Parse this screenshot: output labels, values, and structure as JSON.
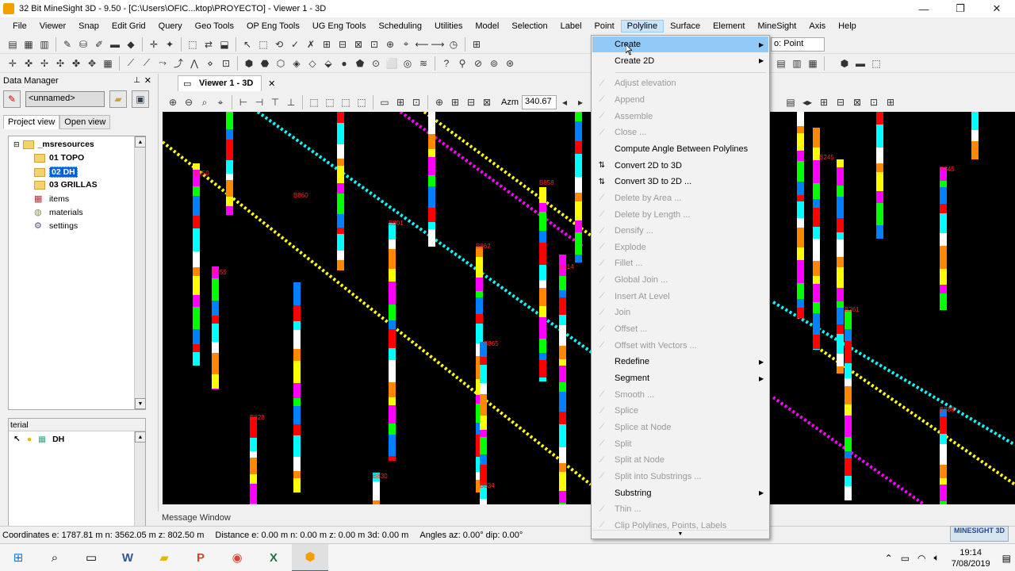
{
  "window": {
    "title": "32 Bit MineSight 3D  - 9.50 - [C:\\Users\\OFIC...ktop\\PROYECTO] - Viewer 1 - 3D",
    "minimize": "—",
    "restore": "❐",
    "close": "✕"
  },
  "menubar": [
    "File",
    "Viewer",
    "Snap",
    "Edit Grid",
    "Query",
    "Geo Tools",
    "OP Eng Tools",
    "UG Eng Tools",
    "Scheduling",
    "Utilities",
    "Model",
    "Selection",
    "Label",
    "Point",
    "Polyline",
    "Surface",
    "Element",
    "MineSight",
    "Axis",
    "Help"
  ],
  "active_menu": "Polyline",
  "toolbar": {
    "snap_mode_text": "o: Point"
  },
  "data_manager": {
    "title": "Data Manager",
    "pin": "📌",
    "close": "✕",
    "combo_value": "<unnamed>",
    "tabs": [
      "Project view",
      "Open view"
    ],
    "tree": [
      {
        "label": "_msresources",
        "type": "folder",
        "bold": true
      },
      {
        "label": "01 TOPO",
        "type": "folder",
        "bold": true
      },
      {
        "label": "02 DH",
        "type": "folder",
        "bold": true,
        "selected": true
      },
      {
        "label": "03 GRILLAS",
        "type": "folder",
        "bold": true
      },
      {
        "label": "items",
        "type": "items",
        "bold": false
      },
      {
        "label": "materials",
        "type": "materials",
        "bold": false
      },
      {
        "label": "settings",
        "type": "settings",
        "bold": false
      }
    ],
    "material_header": "terial",
    "material_row": "DH"
  },
  "viewer": {
    "tab_label": "Viewer 1 - 3D",
    "azm_label": "Azm",
    "azm_value": "340.67",
    "message_window": "Message Window"
  },
  "statusbar": {
    "coordinates": "Coordinates  e: 1787.81 m  n: 3562.05 m  z: 802.50 m",
    "distance": "Distance  e: 0.00 m  n: 0.00 m  z: 0.00 m  3d: 0.00 m",
    "angles": "Angles  az:  0.00°  dip: 0.00°",
    "logo": "MINESIGHT 3D"
  },
  "polyline_menu": {
    "items": [
      {
        "label": "Create",
        "enabled": true,
        "submenu": true,
        "highlight": true,
        "icon": ""
      },
      {
        "label": "Create 2D",
        "enabled": true,
        "submenu": true,
        "icon": ""
      },
      {
        "sep": true
      },
      {
        "label": "Adjust elevation",
        "enabled": false,
        "icon": "adjust-icon"
      },
      {
        "label": "Append",
        "enabled": false,
        "icon": "append-icon"
      },
      {
        "label": "Assemble",
        "enabled": false,
        "icon": "assemble-icon"
      },
      {
        "label": "Close ...",
        "enabled": false,
        "icon": "close-poly-icon"
      },
      {
        "label": "Compute Angle Between Polylines",
        "enabled": true,
        "icon": ""
      },
      {
        "label": "Convert 2D to 3D",
        "enabled": true,
        "icon": "convert-2d-3d-icon"
      },
      {
        "label": "Convert 3D to 2D ...",
        "enabled": true,
        "icon": "convert-3d-2d-icon"
      },
      {
        "label": "Delete by Area ...",
        "enabled": false,
        "icon": "delete-area-icon"
      },
      {
        "label": "Delete by Length ...",
        "enabled": false,
        "icon": "delete-length-icon"
      },
      {
        "label": "Densify ...",
        "enabled": false,
        "icon": "densify-icon"
      },
      {
        "label": "Explode",
        "enabled": false,
        "icon": "explode-icon"
      },
      {
        "label": "Fillet ...",
        "enabled": false,
        "icon": "fillet-icon"
      },
      {
        "label": "Global Join ...",
        "enabled": false,
        "icon": "global-join-icon"
      },
      {
        "label": "Insert At Level",
        "enabled": false,
        "icon": "insert-level-icon"
      },
      {
        "label": "Join",
        "enabled": false,
        "icon": "join-icon"
      },
      {
        "label": "Offset ...",
        "enabled": false,
        "icon": "offset-icon"
      },
      {
        "label": "Offset with Vectors ...",
        "enabled": false,
        "icon": "offset-vectors-icon"
      },
      {
        "label": "Redefine",
        "enabled": true,
        "submenu": true,
        "icon": ""
      },
      {
        "label": "Segment",
        "enabled": true,
        "submenu": true,
        "icon": ""
      },
      {
        "label": "Smooth ...",
        "enabled": false,
        "icon": "smooth-icon"
      },
      {
        "label": "Splice",
        "enabled": false,
        "icon": "splice-icon"
      },
      {
        "label": "Splice at Node",
        "enabled": false,
        "icon": "splice-node-icon"
      },
      {
        "label": "Split",
        "enabled": false,
        "icon": "split-icon"
      },
      {
        "label": "Split at Node",
        "enabled": false,
        "icon": "split-node-icon"
      },
      {
        "label": "Split into Substrings ...",
        "enabled": false,
        "icon": "split-substrings-icon"
      },
      {
        "label": "Substring",
        "enabled": true,
        "submenu": true,
        "icon": ""
      },
      {
        "label": "Thin ...",
        "enabled": false,
        "icon": "thin-icon"
      },
      {
        "label": "Clip Polylines, Points, Labels",
        "enabled": false,
        "icon": "clip-icon"
      }
    ]
  },
  "drillhole_labels": [
    "B855",
    "B860",
    "B858",
    "B862",
    "B865",
    "B828",
    "B830",
    "B834",
    "B245",
    "B845",
    "B261",
    "B888",
    "B801",
    "B250",
    "B814",
    "B824"
  ],
  "taskbar": {
    "time": "19:14",
    "date": "7/08/2019"
  }
}
